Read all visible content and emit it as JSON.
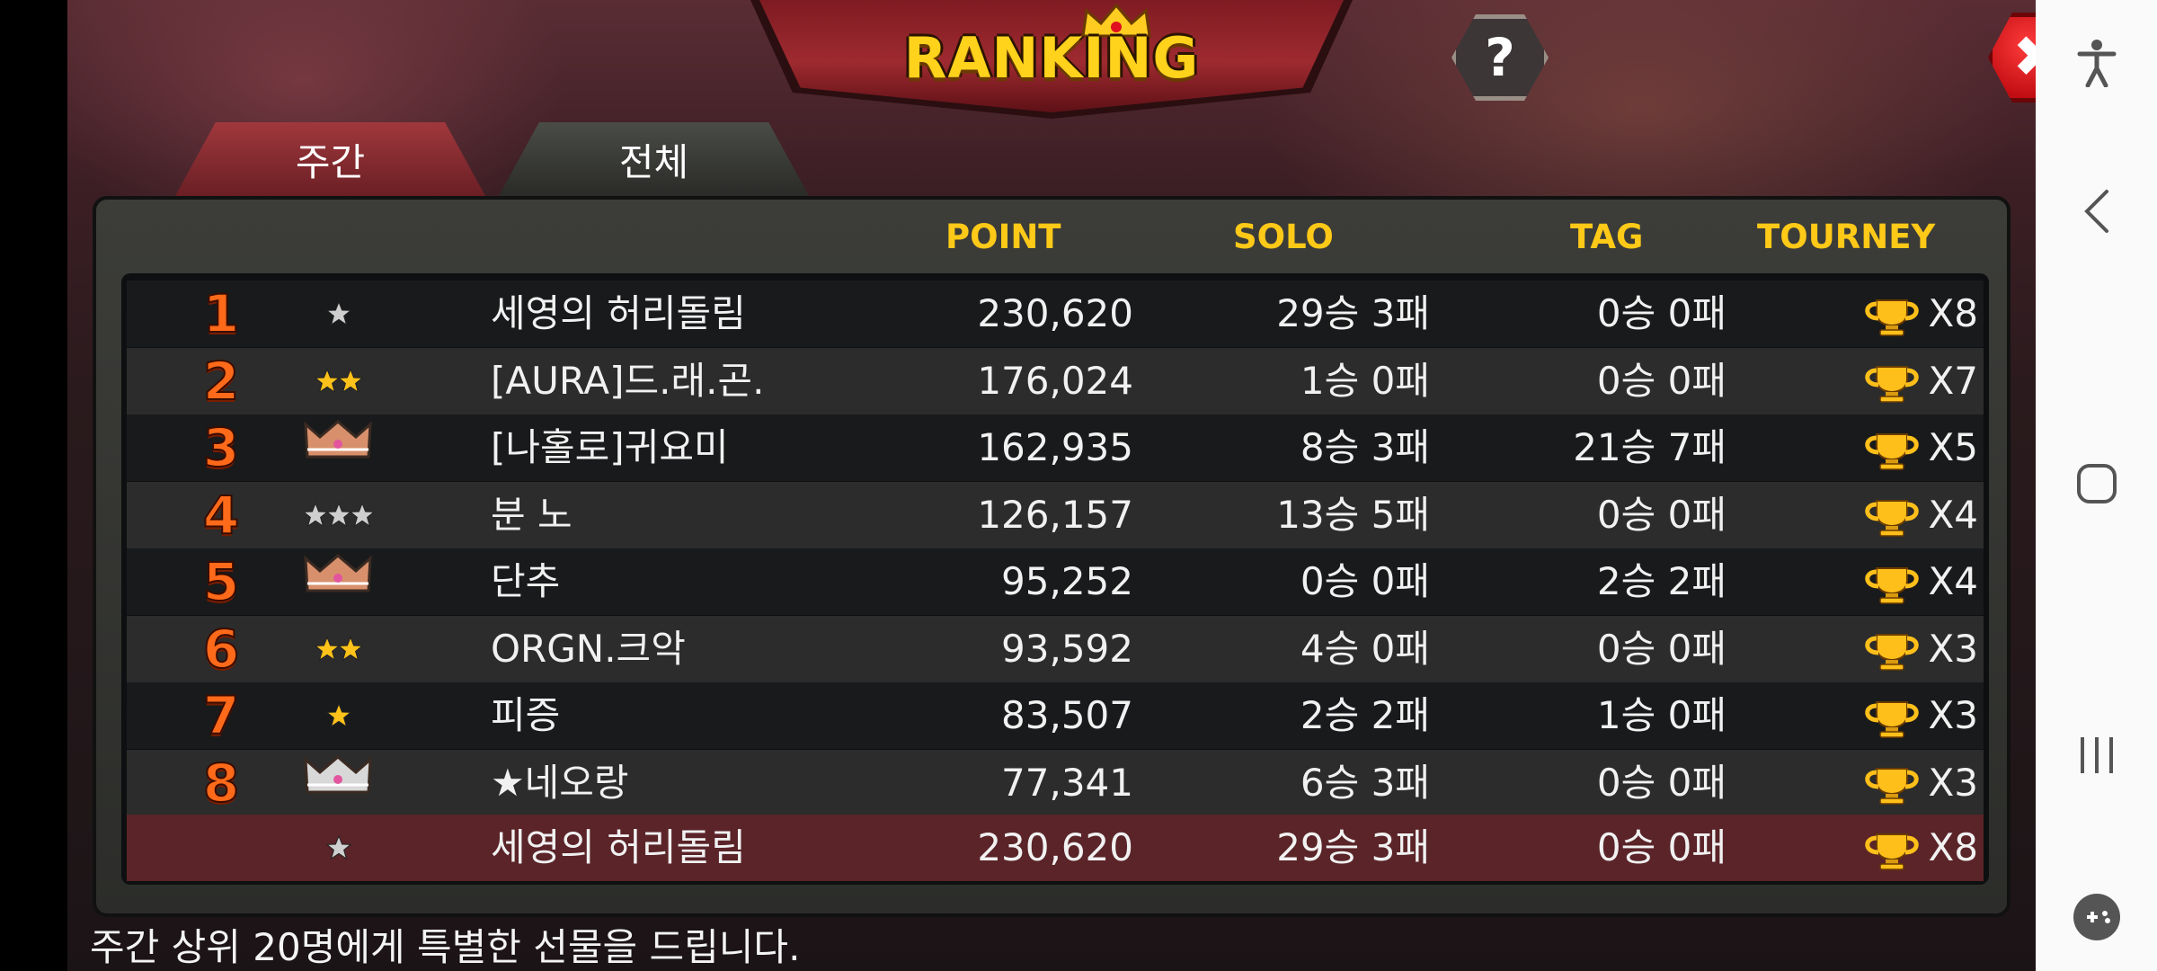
{
  "header": {
    "title": "RANKING",
    "help_label": "?",
    "close_label": "✖"
  },
  "tabs": [
    {
      "label": "주간",
      "active": true
    },
    {
      "label": "전체",
      "active": false
    }
  ],
  "columns": {
    "point": "POINT",
    "solo": "SOLO",
    "tag": "TAG",
    "tourney": "TOURNEY"
  },
  "rows": [
    {
      "rank": "1",
      "badge": "star-silver-1",
      "name": "세영의 허리돌림",
      "point": "230,620",
      "solo": "29승 3패",
      "tag": "0승 0패",
      "tourney": "X8"
    },
    {
      "rank": "2",
      "badge": "star-gold-2",
      "name": "[AURA]드.래.곤.",
      "point": "176,024",
      "solo": "1승 0패",
      "tag": "0승 0패",
      "tourney": "X7"
    },
    {
      "rank": "3",
      "badge": "crown-bronze",
      "name": "[나홀로]귀요미",
      "point": "162,935",
      "solo": "8승 3패",
      "tag": "21승 7패",
      "tourney": "X5"
    },
    {
      "rank": "4",
      "badge": "star-silver-3",
      "name": "분 노",
      "point": "126,157",
      "solo": "13승 5패",
      "tag": "0승 0패",
      "tourney": "X4"
    },
    {
      "rank": "5",
      "badge": "crown-bronze",
      "name": "단추",
      "point": "95,252",
      "solo": "0승 0패",
      "tag": "2승 2패",
      "tourney": "X4"
    },
    {
      "rank": "6",
      "badge": "star-gold-2",
      "name": "ORGN.크악",
      "point": "93,592",
      "solo": "4승 0패",
      "tag": "0승 0패",
      "tourney": "X3"
    },
    {
      "rank": "7",
      "badge": "star-gold-1",
      "name": "피증",
      "point": "83,507",
      "solo": "2승 2패",
      "tag": "1승 0패",
      "tourney": "X3"
    },
    {
      "rank": "8",
      "badge": "crown-silver",
      "name": "★네오랑",
      "point": "77,341",
      "solo": "6승 3패",
      "tag": "0승 0패",
      "tourney": "X3"
    }
  ],
  "my_row": {
    "rank": "",
    "badge": "star-silver-1",
    "name": "세영의 허리돌림",
    "point": "230,620",
    "solo": "29승 3패",
    "tag": "0승 0패",
    "tourney": "X8"
  },
  "footer": "주간 상위 20명에게 특별한 선물을 드립니다.",
  "colors": {
    "accent": "#ffc918",
    "rank": "#ff6a1a",
    "me_row": "#5a2428"
  }
}
